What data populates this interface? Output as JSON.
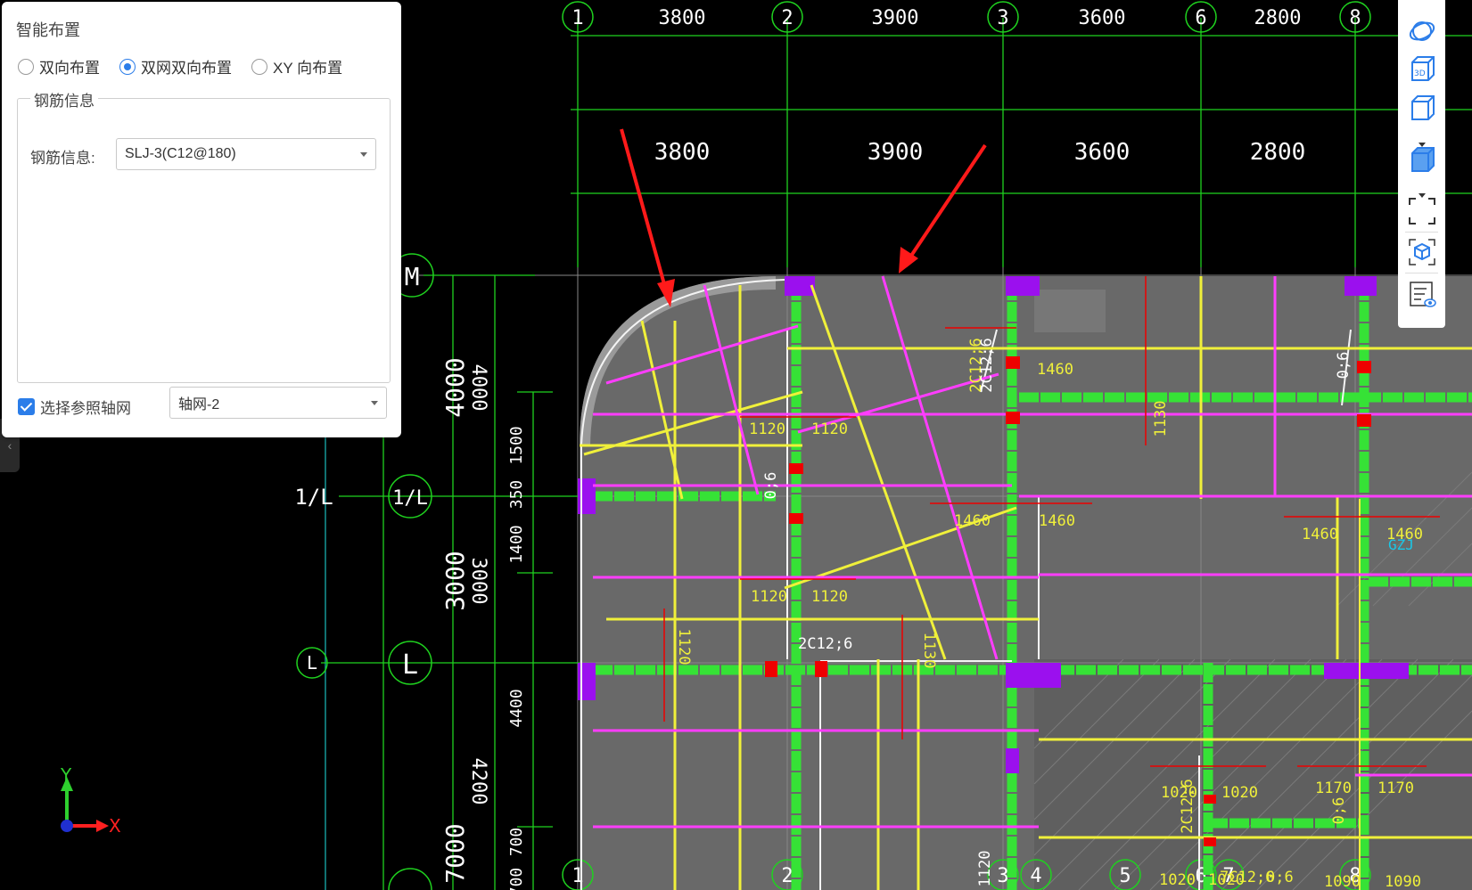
{
  "panel": {
    "title": "智能布置",
    "radios": [
      {
        "label": "双向布置",
        "selected": false
      },
      {
        "label": "双网双向布置",
        "selected": true
      },
      {
        "label": "XY 向布置",
        "selected": false
      }
    ],
    "group_title": "钢筋信息",
    "rebar_label": "钢筋信息:",
    "rebar_value": "SLJ-3(C12@180)",
    "ref_grid_label": "选择参照轴网",
    "ref_grid_checked": true,
    "ref_grid_value": "轴网-2"
  },
  "toolbar": {
    "icons": [
      "orbit-icon",
      "view-3d-icon",
      "box-view-icon",
      "solid-view-icon",
      "fit-view-icon",
      "cube-view-icon",
      "layer-display-icon"
    ]
  },
  "axes": {
    "top_labels": [
      "1",
      "2",
      "3",
      "6",
      "8"
    ],
    "top_dims": [
      "3800",
      "3900",
      "3600",
      "2800"
    ],
    "top_dims_second": [
      "3800",
      "3900",
      "3600",
      "2800"
    ],
    "left_labels": [
      "M",
      "1/L",
      "L"
    ],
    "left_labels_outer": [
      "1/L",
      "L"
    ],
    "left_dims_major": [
      "4000",
      "3000",
      "7000"
    ],
    "left_dims_rot": [
      "4000",
      "3000",
      "4200"
    ],
    "left_dims_small": [
      "1500",
      "350",
      "1400",
      "4400",
      "700",
      "700"
    ],
    "bottom_labels": [
      "1",
      "2",
      "3",
      "4",
      "5",
      "6",
      "7",
      "8"
    ]
  },
  "annotations": {
    "yellow": [
      "1120",
      "1120",
      "1120",
      "1120",
      "1460",
      "1460",
      "1460",
      "1460",
      "1130",
      "1120",
      "1130",
      "2C12;6",
      "1020",
      "1020",
      "1170",
      "1170",
      "1020",
      "1020",
      "1090",
      "1090",
      "1460",
      "7C12;6",
      "0;6",
      "2C12;6",
      "0;6"
    ],
    "white": [
      "2C12;6",
      "0;6",
      "2C12;6",
      "0;6",
      "1120"
    ],
    "cyan": [
      "GZJ"
    ]
  },
  "ucs": {
    "x": "X",
    "y": "Y"
  }
}
